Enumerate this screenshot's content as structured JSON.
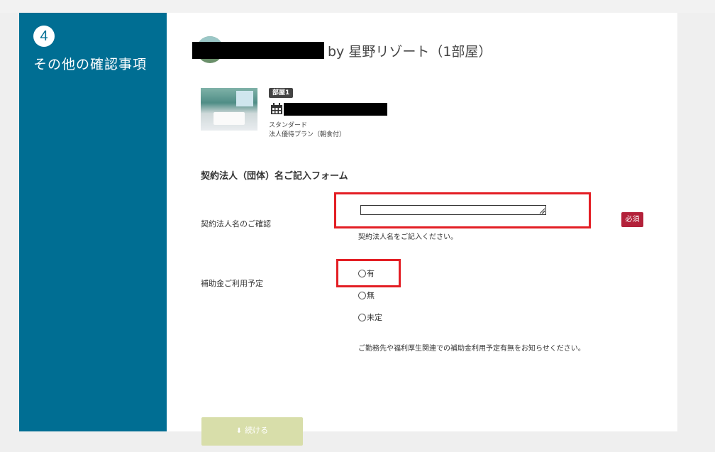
{
  "sidebar": {
    "step_number": "4",
    "step_title": "その他の確認事項"
  },
  "hotel": {
    "name_suffix": "by 星野リゾート（1部屋）"
  },
  "room": {
    "badge": "部屋1",
    "type": "スタンダード",
    "plan": "法人優待プラン（朝食付）"
  },
  "form": {
    "heading": "契約法人（団体）名ご記入フォーム",
    "corp_name": {
      "label": "契約法人名のご確認",
      "value": "",
      "required_badge": "必須",
      "hint": "契約法人名をご記入ください。"
    },
    "subsidy": {
      "label": "補助金ご利用予定",
      "options": [
        "有",
        "無",
        "未定"
      ],
      "hint": "ご勤務先や福利厚生関連での補助金利用予定有無をお知らせください。"
    }
  },
  "actions": {
    "continue_label": "続ける"
  },
  "colors": {
    "sidebar_bg": "#006e93",
    "required_badge": "#b3213a",
    "highlight": "#e31e24",
    "continue_bg": "#d8deaa"
  }
}
